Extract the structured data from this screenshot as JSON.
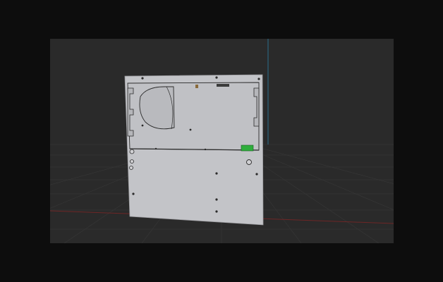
{
  "viewport": {
    "background": "#2a2a2a",
    "grid_color": "#3a3a3a",
    "x_axis_color": "#7a2a2a",
    "y_axis_color": "#2a6a8a"
  },
  "model": {
    "panel_color": "#c4c5c9",
    "outline_color": "#2b2b2b",
    "connector_color": "#2fae3c",
    "connector_icon": "green-connector-icon",
    "fan_icon": "fan-cutout-icon"
  }
}
